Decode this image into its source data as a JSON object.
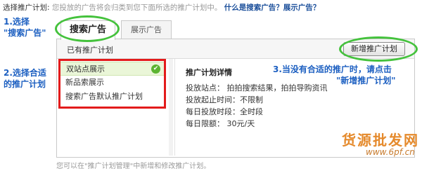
{
  "header": {
    "label": "选择推广计划:",
    "hint": "您投放的广告将会归类到您下面所选的推广计划中。",
    "link": "什么是搜索广告？展示广告？"
  },
  "tabs": [
    {
      "label": "搜索广告"
    },
    {
      "label": "展示广告"
    }
  ],
  "panel": {
    "title": "已有推广计划",
    "new_button": "新增推广计划"
  },
  "plans": [
    {
      "label": "双站点展示",
      "selected": true
    },
    {
      "label": "新品索展示",
      "selected": false
    },
    {
      "label": "搜索广告默认推广计划",
      "selected": false
    }
  ],
  "details": {
    "title": "推广计划详情",
    "sites": "投放站点：  拍拍搜索结果，拍拍导购资讯",
    "time": "投放起止时间：不限制",
    "daily": "每日投放时段：全时段",
    "budget": "每日限额：  30元/天"
  },
  "footer": "您可以在\"推广计划管理\"中新增和修改推广计划。",
  "annotations": {
    "a1_line1": "1.选择",
    "a1_line2": "\"搜索广告\"",
    "a2_line1": "2.选择合适",
    "a2_line2": "的推广计划",
    "a3_line1": "3.当没有合适的推广时，请点击",
    "a3_line2": "\"新增推广计划\""
  },
  "watermark": {
    "text": "货源批发网",
    "url": "www.6pf.cn"
  },
  "colors": {
    "annotation_blue": "#1c5fc1",
    "highlight_green": "#44c23c",
    "highlight_red": "#e31b1b",
    "link_blue": "#1a4e9a"
  }
}
